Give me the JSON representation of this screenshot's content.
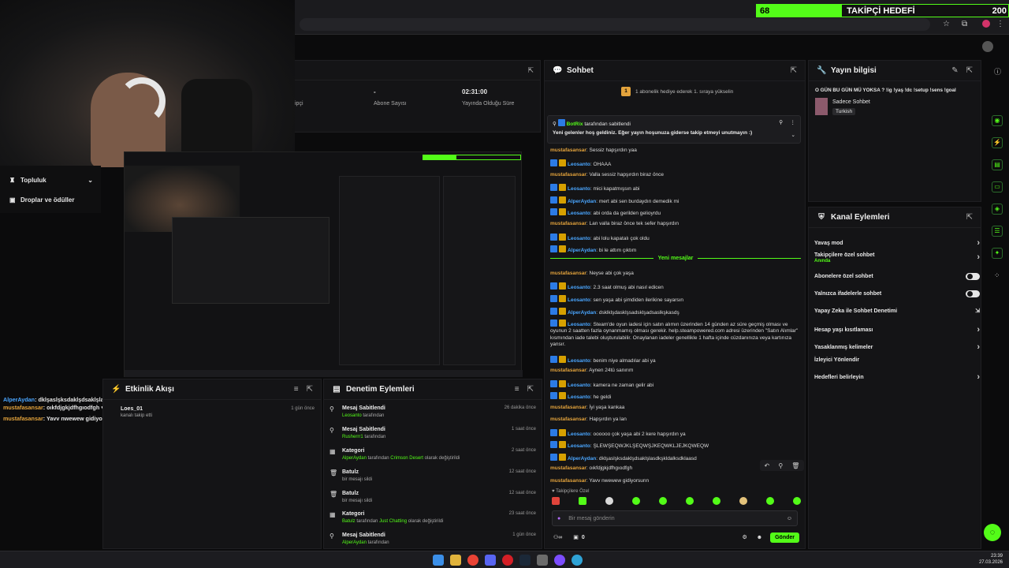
{
  "overlay": {
    "goal_count": "68",
    "goal_label": "TAKİPÇİ HEDEFİ",
    "goal_target": "200"
  },
  "stats": [
    {
      "value": "",
      "label": "ipçi"
    },
    {
      "value": "-",
      "label": "Abone Sayısı"
    },
    {
      "value": "02:31:00",
      "label": "Yayında Olduğu Süre"
    }
  ],
  "left_nav": [
    {
      "label": "Topluluk",
      "icon": "community-icon"
    },
    {
      "label": "Droplar ve ödüller",
      "icon": "gift-icon"
    }
  ],
  "overlay_chat": [
    {
      "user": "AlperAydan",
      "text": ": dklşaslşksdaklşdsaklşlasdkşkldalksdklaasd"
    },
    {
      "user": "mustafasansar",
      "text": ": oıkfdjgkjdfhgıodfgh"
    },
    {
      "user": "mustafasansar",
      "text": ": Yavv nwewew gidiyorsunn"
    }
  ],
  "follow_event": {
    "name": "Loes_01",
    "text": "kanalı takip etti",
    "time": "1 gün önce"
  },
  "activity": {
    "title": "Etkinlik Akışı"
  },
  "moderation": {
    "title": "Denetim Eylemleri",
    "items": [
      {
        "title": "Mesaj Sabitlendi",
        "user": "Leosanto",
        "rest": "tarafından",
        "time": "26 dakika önce",
        "icon": "pin-icon"
      },
      {
        "title": "Mesaj Sabitlendi",
        "user": "Rusherrr1",
        "rest": "tarafından",
        "time": "1 saat önce",
        "icon": "pin-icon"
      },
      {
        "title": "Kategori",
        "user": "AlperAydan",
        "rest": "tarafından",
        "extra": "Crimson Desert",
        "rest2": "olarak değiştirildi",
        "time": "2 saat önce",
        "icon": "category-icon"
      },
      {
        "title": "Batulz",
        "user": "",
        "rest": "bir mesajı sildi",
        "time": "12 saat önce",
        "icon": "trash-icon"
      },
      {
        "title": "Batulz",
        "user": "",
        "rest": "bir mesajı sildi",
        "time": "12 saat önce",
        "icon": "trash-icon"
      },
      {
        "title": "Kategori",
        "user": "Batulz",
        "rest": "tarafından",
        "extra": "Just Chatting",
        "rest2": "olarak değiştirildi",
        "time": "23 saat önce",
        "icon": "category-icon"
      },
      {
        "title": "Mesaj Sabitlendi",
        "user": "AlperAydan",
        "rest": "tarafından",
        "time": "1 gün önce",
        "icon": "pin-icon"
      }
    ]
  },
  "chat": {
    "title": "Sohbet",
    "sub_banner": "1 abonelik hediye ederek 1. sıraya yükselin",
    "pinned_by": "BotRix",
    "pinned_suffix": "tarafından sabitlendi",
    "pinned_text": "Yeni gelenler hoş geldiniz. Eğer yayın hoşunuza giderse takip etmeyi unutmayın :)",
    "new_messages": "Yeni mesajlar",
    "messages": [
      {
        "user": "mustafasansar",
        "c": "g",
        "text": ": Sessiz hapşırdın yaa"
      },
      {
        "user": "Leosanto",
        "c": "b",
        "text": ": OHAAA"
      },
      {
        "user": "mustafasansar",
        "c": "g",
        "text": ": Valla sessiz hapşırdın biraz önce"
      },
      {
        "user": "Leosanto",
        "c": "b",
        "text": ": mici kapatmışsın abi"
      },
      {
        "user": "AlperAydan",
        "c": "b",
        "text": ": mert abi sen burdaydın demedik mi"
      },
      {
        "user": "Leosanto",
        "c": "b",
        "text": ": abi orda da gerilden gelioyrdu"
      },
      {
        "user": "mustafasansar",
        "c": "g",
        "text": ": Lan valla biraz önce tek sefer hapşırdın"
      },
      {
        "user": "Leosanto",
        "c": "b",
        "text": ": abi lolu kapatalı çok oldu"
      },
      {
        "user": "AlperAydan",
        "c": "b",
        "text": ": bi le attım çıktım"
      },
      {
        "user": "mustafasansar",
        "c": "g",
        "text": ": Neyse abi çok yaşa"
      },
      {
        "user": "Leosanto",
        "c": "b",
        "text": ": 2.3 saat olmuş abi nasıl edicen"
      },
      {
        "user": "Leosanto",
        "c": "b",
        "text": ": sen yaşa abi şimdiden ilerikine sayarsın"
      },
      {
        "user": "AlperAydan",
        "c": "b",
        "text": ": dsklklşdasklşsadsklşadsaslkşkasdş"
      },
      {
        "user": "Leosanto",
        "c": "b",
        "text": ": Steam'de oyun iadesi için satın alımın üzerinden 14 günden az süre geçmiş olması ve oyunun 2 saatten fazla oynanmamış olması gerekir. help.steampowered.com adresi üzerinden \"Satın Alımlar\" kısmından iade talebi oluşturulabilir. Onaylanan iadeler genellikle 1 hafta içinde cüzdanınıza veya kartınıza yansır."
      },
      {
        "user": "Leosanto",
        "c": "b",
        "text": ": benim niye almadılar abi ya"
      },
      {
        "user": "mustafasansar",
        "c": "g",
        "text": ": Aynen 24tü sanırım"
      },
      {
        "user": "Leosanto",
        "c": "b",
        "text": ": kamera ne zaman gelir abi"
      },
      {
        "user": "Leosanto",
        "c": "b",
        "text": ": he geldi"
      },
      {
        "user": "mustafasansar",
        "c": "g",
        "text": ": İyi yaşa kankaa"
      },
      {
        "user": "mustafasansar",
        "c": "g",
        "text": ": Hapşırdın ya lan"
      },
      {
        "user": "Leosanto",
        "c": "b",
        "text": ": oooooo çok yaşa abi 2 kere hapşırdın ya"
      },
      {
        "user": "Leosanto",
        "c": "b",
        "text": ": ŞLEWŞEQWJKLŞEQWŞJKEQWKLJEJKQWEQW"
      },
      {
        "user": "AlperAydan",
        "c": "b",
        "text": ": dklşaslşksdaklşdsaklşlasdkşkldalksdklaasd"
      },
      {
        "user": "mustafasansar",
        "c": "g",
        "text": ": oıkfdjgkjdfhgıodfgh"
      },
      {
        "user": "mustafasansar",
        "c": "g",
        "text": ": Yavv nwewew gidiyorsunn"
      }
    ],
    "follower_label": "Takipçilere Özel",
    "input_placeholder": "Bir mesaj gönderin",
    "count": "0",
    "send": "Gönder"
  },
  "stream_info": {
    "title": "Yayın bilgisi",
    "headline": "O GÜN BU GÜN MÜ YOKSA ? !ig !yaş !dc !setup !sens !goal",
    "category": "Sadece Sohbet",
    "tag": "Turkish"
  },
  "channel_actions": {
    "title": "Kanal Eylemleri",
    "items": [
      {
        "label": "Yavaş mod",
        "control": "chevron"
      },
      {
        "label": "Takipçilere özel sohbet",
        "sub": "Anında",
        "control": "chevron"
      },
      {
        "label": "Abonelere özel sohbet",
        "control": "toggle"
      },
      {
        "label": "Yalnızca ifadelerle sohbet",
        "control": "toggle"
      },
      {
        "label": "Yapay Zeka ile Sohbet Denetimi",
        "control": "ext"
      },
      {
        "label": "Hesap yaşı kısıtlaması",
        "control": "chevron"
      },
      {
        "label": "Yasaklanmış kelimeler",
        "control": "chevron"
      },
      {
        "label": "İzleyici Yönlendir",
        "control": "none"
      },
      {
        "label": "Hedefleri belirleyin",
        "control": "chevron"
      }
    ]
  },
  "taskbar": {
    "time": "23:39",
    "date": "27.03.2026"
  },
  "colors": {
    "accent": "#53fc18",
    "username_gold": "#e3a33c",
    "username_blue": "#4aa6ff"
  }
}
